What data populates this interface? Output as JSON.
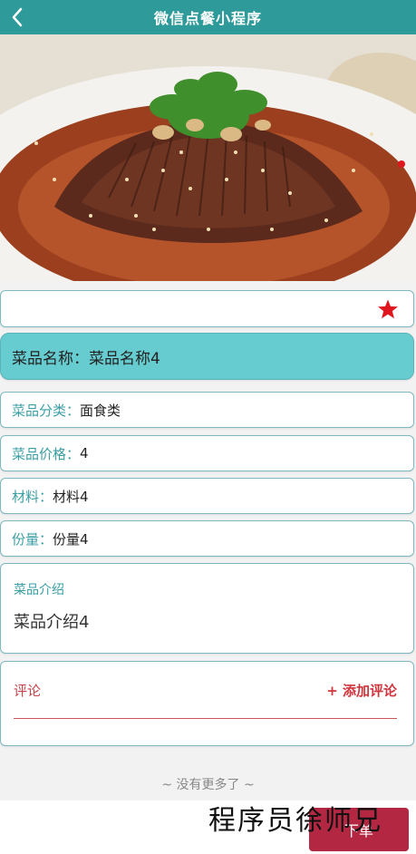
{
  "header": {
    "title": "微信点餐小程序"
  },
  "dish": {
    "name_label": "菜品名称：",
    "name_value": "菜品名称4",
    "rows": [
      {
        "label": "菜品分类：",
        "value": "面食类"
      },
      {
        "label": "菜品价格：",
        "value": "4"
      },
      {
        "label": "材料：",
        "value": "材料4"
      },
      {
        "label": "份量：",
        "value": "份量4"
      }
    ],
    "intro_label": "菜品介绍",
    "intro_text": "菜品介绍4"
  },
  "comments": {
    "label": "评论",
    "add_label": "+ 添加评论"
  },
  "footer": {
    "no_more": "~ 没有更多了 ~",
    "order_label": "下单",
    "watermark": "程序员徐师兄"
  },
  "colors": {
    "header": "#2f9a9a",
    "name_bar": "#66ccd0",
    "accent": "#3a9ea4",
    "order": "#b32742",
    "star": "#e0161e"
  }
}
